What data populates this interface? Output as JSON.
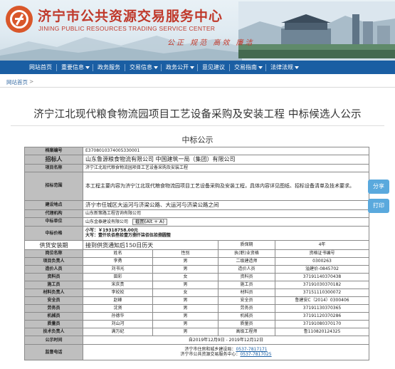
{
  "header": {
    "title": "济宁市公共资源交易服务中心",
    "subtitle": "JINING PUBLIC RESOURCES TRADING SERVICE CENTER",
    "slogan": "公正  规范  高效  廉洁",
    "brand_color": "#c0392b"
  },
  "nav": {
    "color": "#1a5ea3",
    "items": [
      {
        "label": "网站首页",
        "dropdown": false
      },
      {
        "label": "重要信息",
        "dropdown": true
      },
      {
        "label": "政务服务",
        "dropdown": false
      },
      {
        "label": "交易信息",
        "dropdown": true
      },
      {
        "label": "政务公开",
        "dropdown": true
      },
      {
        "label": "意见建议",
        "dropdown": false
      },
      {
        "label": "交易指南",
        "dropdown": true
      },
      {
        "label": "法律法规",
        "dropdown": true
      }
    ]
  },
  "breadcrumb": {
    "home": "网站首页",
    "sep": ">",
    "current": ""
  },
  "page_title": "济宁江北现代粮食物流园项目工艺设备采购及安装工程  中标候选人公示",
  "doc_heading": "中标公示",
  "table": {
    "rows_info": [
      {
        "label": "档案编号",
        "value": "E3708010374005330001"
      },
      {
        "label": "招标人",
        "value": "山东鲁源粮食物流有限公司   中国建筑一局（集团）有限公司"
      },
      {
        "label": "项目名称",
        "value": "济宁江北现代粮食物流园项目工艺设备采购及安装工程"
      },
      {
        "label": "招标范围",
        "value": "本工程主要内容为济宁江北现代粮食物流园项目工艺设备采购及安装工程，具体内容详见图纸、招标设备清单及技术要求。"
      },
      {
        "label": "建设地点",
        "value": "济宁市任城区大运河与济梁公路、大运河与济梁公路之间"
      },
      {
        "label": "代理机构",
        "value": "山东新策路工程咨询有限公司"
      },
      {
        "label": "中标单位",
        "value": "山东金泰建设有限公司",
        "tooltip": "截图(Alt + A)"
      },
      {
        "label": "中标价格",
        "value_line1": "小写：￥19318758.00元",
        "value_line2": "大写：壹仟玖佰叁拾壹万捌仟柒佰伍拾捌圆整"
      }
    ],
    "schedule": {
      "label": "供货安装期",
      "value": "接到供货通知后150日历天",
      "period_label": "质保期",
      "period_value": "4年"
    },
    "staff_header": {
      "role": "岗位名称",
      "name": "姓名",
      "gender": "性别",
      "qualification": "执(职)业资格",
      "cert": "资格证书编号"
    },
    "staff": [
      {
        "role": "项目负责人",
        "name": "李勇",
        "gender": "男",
        "qualification": "二级建造师",
        "cert": "0300263"
      },
      {
        "role": "造价人员",
        "name": "刘书光",
        "gender": "男",
        "qualification": "造价人员",
        "cert": "溢建价-0845702"
      },
      {
        "role": "资料员",
        "name": "田彩",
        "gender": "女",
        "qualification": "资料员",
        "cert": "37191140370438"
      },
      {
        "role": "施工员",
        "name": "宋庆贵",
        "gender": "男",
        "qualification": "施工员",
        "cert": "37191030370182"
      },
      {
        "role": "材料负责人",
        "name": "李姣姣",
        "gender": "女",
        "qualification": "材料员",
        "cert": "37151110300072"
      },
      {
        "role": "安全员",
        "name": "赵峰",
        "gender": "男",
        "qualification": "安全员",
        "cert": "鲁建安C（2014）0300406"
      },
      {
        "role": "劳务员",
        "name": "沈贤",
        "gender": "男",
        "qualification": "劳务员",
        "cert": "37191130370365"
      },
      {
        "role": "机械员",
        "name": "孙德华",
        "gender": "男",
        "qualification": "机械员",
        "cert": "37191120370286"
      },
      {
        "role": "质量员",
        "name": "刘山河",
        "gender": "男",
        "qualification": "质量员",
        "cert": "37191080370170"
      },
      {
        "role": "技术负责人",
        "name": "满万纪",
        "gender": "男",
        "qualification": "高级工程师",
        "cert": "鲁110820124325"
      }
    ],
    "publicity": {
      "label": "公示时间",
      "value": "自2019年12月9日 - 2019年12月12日"
    },
    "supervision": {
      "label": "监督电话",
      "line1_prefix": "济宁市住房和城乡建设局：",
      "line1_phone": "0537-7817171",
      "line2_prefix": "济宁市公共资源交易服务中心：",
      "line2_phone": "0537-7817025"
    }
  },
  "float_buttons": {
    "share": "分享",
    "print": "打印",
    "color": "#5aa9dd"
  }
}
